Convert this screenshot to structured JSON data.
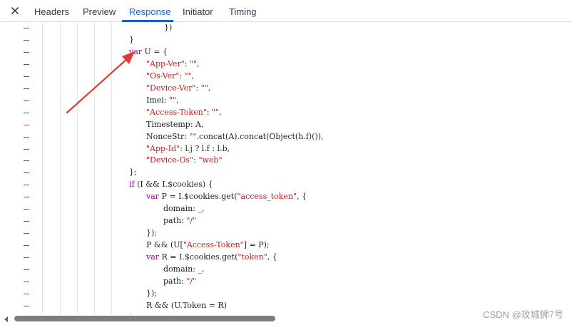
{
  "tabs": [
    {
      "label": "Headers"
    },
    {
      "label": "Preview"
    },
    {
      "label": "Response",
      "active": true
    },
    {
      "label": "Initiator"
    },
    {
      "label": "Timing"
    }
  ],
  "icons": {
    "close": "close-icon",
    "scroll_left": "chevron-left-icon"
  },
  "colors": {
    "accent": "#1a5fcf",
    "keyword": "#a800a8",
    "string": "#c41a16",
    "annotation_arrow": "#e53935"
  },
  "response": {
    "lines": [
      [
        {
          "t": "})"
        }
      ],
      [
        {
          "t": "}"
        }
      ],
      [
        {
          "t": "var",
          "c": "kw"
        },
        {
          "t": " U = {"
        }
      ],
      [
        {
          "t": "\"App-Ver\"",
          "c": "str"
        },
        {
          "t": ": "
        },
        {
          "t": "\"\"",
          "c": "str"
        },
        {
          "t": ","
        }
      ],
      [
        {
          "t": "\"Os-Ver\"",
          "c": "str"
        },
        {
          "t": ": "
        },
        {
          "t": "\"\"",
          "c": "str"
        },
        {
          "t": ","
        }
      ],
      [
        {
          "t": "\"Device-Ver\"",
          "c": "str"
        },
        {
          "t": ": "
        },
        {
          "t": "\"\"",
          "c": "str"
        },
        {
          "t": ","
        }
      ],
      [
        {
          "t": "Imei: "
        },
        {
          "t": "\"\"",
          "c": "str"
        },
        {
          "t": ","
        }
      ],
      [
        {
          "t": "\"Access-Token\"",
          "c": "str"
        },
        {
          "t": ": "
        },
        {
          "t": "\"\"",
          "c": "str"
        },
        {
          "t": ","
        }
      ],
      [
        {
          "t": "Timestemp: A,"
        }
      ],
      [
        {
          "t": "NonceStr: "
        },
        {
          "t": "\"\"",
          "c": "str"
        },
        {
          "t": ".concat(A).concat(Object(h.f)()),"
        }
      ],
      [
        {
          "t": "\"App-Id\"",
          "c": "str"
        },
        {
          "t": ": l.j ? l.f : l.b,"
        }
      ],
      [
        {
          "t": "\"Device-Os\"",
          "c": "str"
        },
        {
          "t": ": "
        },
        {
          "t": "\"web\"",
          "c": "str"
        }
      ],
      [
        {
          "t": "};"
        }
      ],
      [
        {
          "t": "if",
          "c": "kw"
        },
        {
          "t": " (I && I.$cookies) {"
        }
      ],
      [
        {
          "t": "var",
          "c": "kw"
        },
        {
          "t": " P = I.$cookies.get("
        },
        {
          "t": "\"access_token\"",
          "c": "str"
        },
        {
          "t": ", {"
        }
      ],
      [
        {
          "t": "domain: _,"
        }
      ],
      [
        {
          "t": "path: "
        },
        {
          "t": "\"/\"",
          "c": "str"
        }
      ],
      [
        {
          "t": "});"
        }
      ],
      [
        {
          "t": "P && (U["
        },
        {
          "t": "\"Access-Token\"",
          "c": "str"
        },
        {
          "t": "] = P);"
        }
      ],
      [
        {
          "t": "var",
          "c": "kw"
        },
        {
          "t": " R = I.$cookies.get("
        },
        {
          "t": "\"token\"",
          "c": "str"
        },
        {
          "t": ", {"
        }
      ],
      [
        {
          "t": "domain: _,"
        }
      ],
      [
        {
          "t": "path: "
        },
        {
          "t": "\"/\"",
          "c": "str"
        }
      ],
      [
        {
          "t": "});"
        }
      ],
      [
        {
          "t": "R && (U.Token = R)"
        }
      ],
      [
        {
          "t": "}"
        }
      ]
    ]
  },
  "watermark": "CSDN @玫城狮7号"
}
